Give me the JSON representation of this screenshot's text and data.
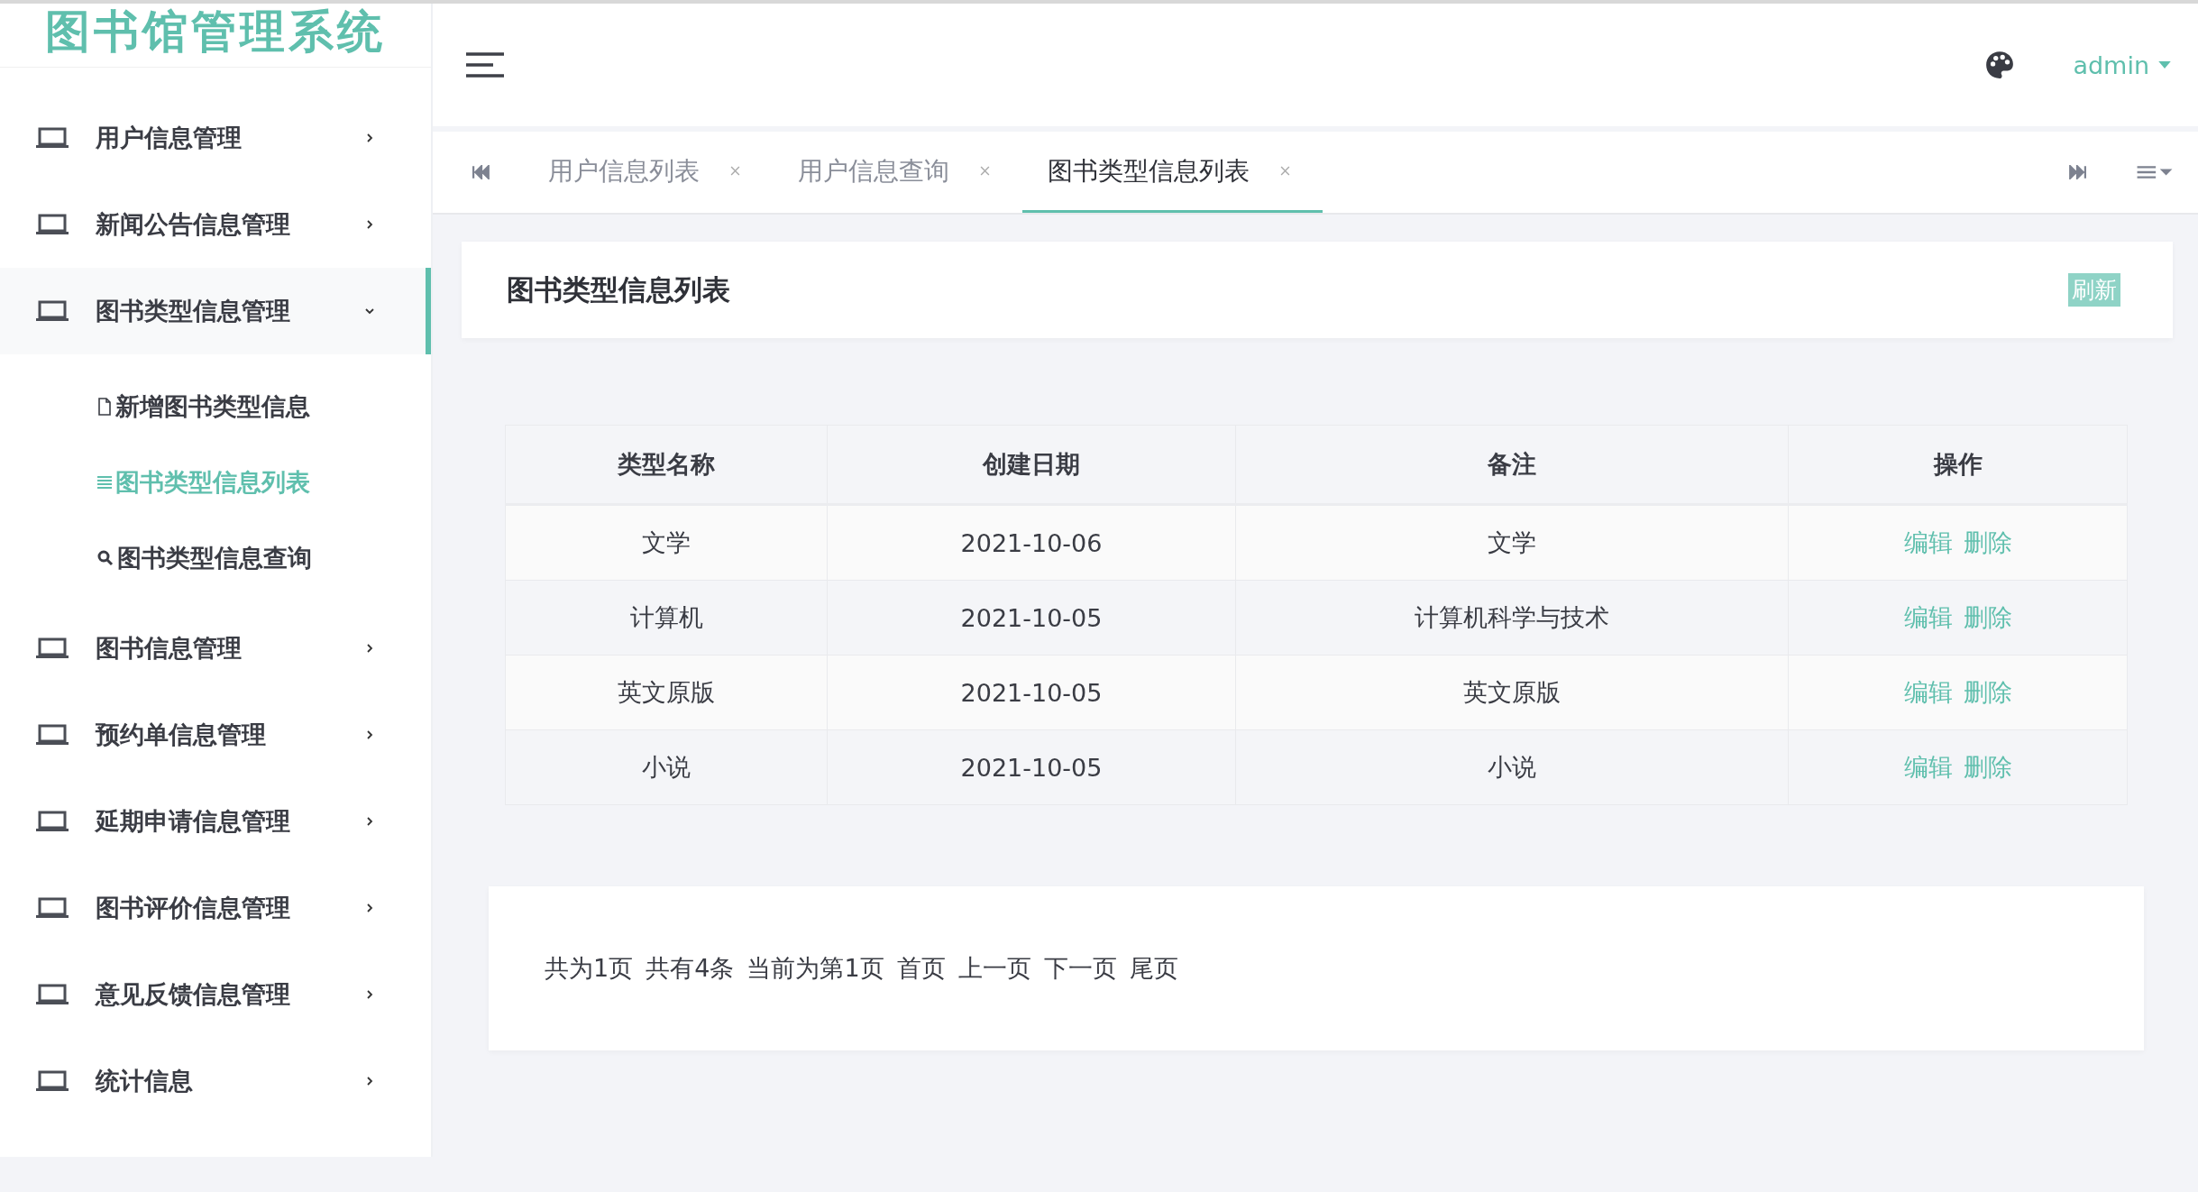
{
  "sidebar": {
    "title": "图书馆管理系统",
    "items": [
      {
        "label": "用户信息管理",
        "expanded": false
      },
      {
        "label": "新闻公告信息管理",
        "expanded": false
      },
      {
        "label": "图书类型信息管理",
        "expanded": true,
        "children": [
          {
            "label": "新增图书类型信息",
            "kind": "add",
            "selected": false
          },
          {
            "label": "图书类型信息列表",
            "kind": "list",
            "selected": true
          },
          {
            "label": "图书类型信息查询",
            "kind": "search",
            "selected": false
          }
        ]
      },
      {
        "label": "图书信息管理",
        "expanded": false
      },
      {
        "label": "预约单信息管理",
        "expanded": false
      },
      {
        "label": "延期申请信息管理",
        "expanded": false
      },
      {
        "label": "图书评价信息管理",
        "expanded": false
      },
      {
        "label": "意见反馈信息管理",
        "expanded": false
      },
      {
        "label": "统计信息",
        "expanded": false
      }
    ]
  },
  "header": {
    "user": "admin"
  },
  "tabs": [
    {
      "label": "用户信息列表",
      "selected": false
    },
    {
      "label": "用户信息查询",
      "selected": false
    },
    {
      "label": "图书类型信息列表",
      "selected": true
    }
  ],
  "panel": {
    "title": "图书类型信息列表",
    "refresh": "刷新"
  },
  "table": {
    "columns": [
      "类型名称",
      "创建日期",
      "备注",
      "操作"
    ],
    "rows": [
      {
        "name": "文学",
        "date": "2021-10-06",
        "note": "文学",
        "actions": [
          "编辑",
          "删除"
        ]
      },
      {
        "name": "计算机",
        "date": "2021-10-05",
        "note": "计算机科学与技术",
        "actions": [
          "编辑",
          "删除"
        ]
      },
      {
        "name": "英文原版",
        "date": "2021-10-05",
        "note": "英文原版",
        "actions": [
          "编辑",
          "删除"
        ]
      },
      {
        "name": "小说",
        "date": "2021-10-05",
        "note": "小说",
        "actions": [
          "编辑",
          "删除"
        ]
      }
    ]
  },
  "pagination": [
    "共为1页",
    "共有4条",
    "当前为第1页",
    "首页",
    "上一页",
    "下一页",
    "尾页"
  ]
}
